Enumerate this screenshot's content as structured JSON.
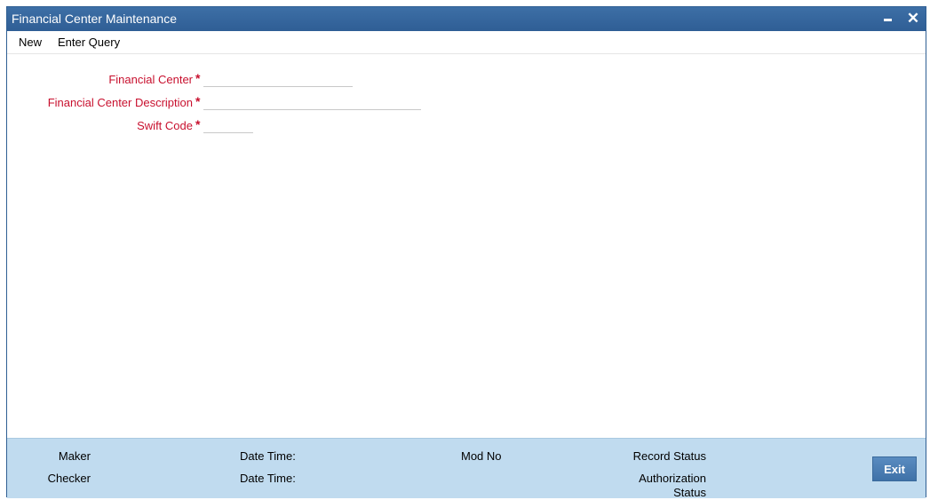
{
  "window": {
    "title": "Financial Center Maintenance",
    "minimize_icon": "minimize-icon",
    "close_label": "✕"
  },
  "menu": {
    "new_label": "New",
    "enter_query_label": "Enter Query"
  },
  "form": {
    "required_marker": "*",
    "financial_center": {
      "label": "Financial Center",
      "value": ""
    },
    "financial_center_description": {
      "label": "Financial Center Description",
      "value": ""
    },
    "swift_code": {
      "label": "Swift Code",
      "value": ""
    }
  },
  "footer": {
    "maker_label": "Maker",
    "checker_label": "Checker",
    "maker_datetime_label": "Date Time:",
    "checker_datetime_label": "Date Time:",
    "mod_no_label": "Mod No",
    "record_status_label": "Record Status",
    "authorization_status_line1": "Authorization",
    "authorization_status_line2": "Status",
    "exit_label": "Exit"
  },
  "colors": {
    "titlebar": "#2f5e95",
    "required_label": "#c8102e",
    "footer_bg": "#c0dbef",
    "exit_button": "#4a7db3"
  }
}
